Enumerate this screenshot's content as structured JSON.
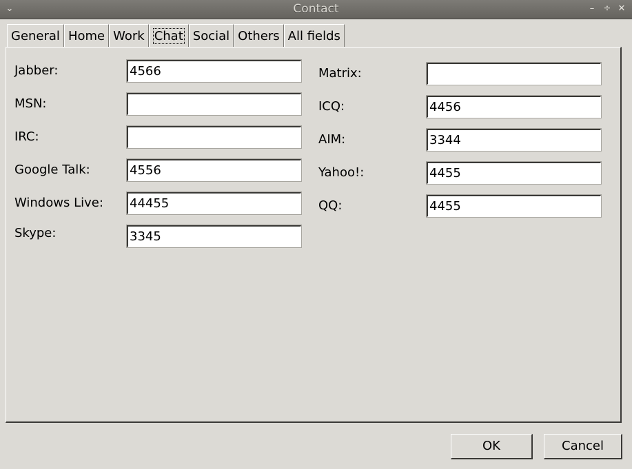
{
  "window": {
    "title": "Contact",
    "menu_icon": "chevron-down-icon",
    "minimize_icon": "minimize-icon",
    "maximize_icon": "maximize-icon",
    "close_icon": "close-icon"
  },
  "tabs": [
    {
      "label": "General",
      "active": false
    },
    {
      "label": "Home",
      "active": false
    },
    {
      "label": "Work",
      "active": false
    },
    {
      "label": "Chat",
      "active": true
    },
    {
      "label": "Social",
      "active": false
    },
    {
      "label": "Others",
      "active": false
    },
    {
      "label": "All fields",
      "active": false
    }
  ],
  "left_fields": [
    {
      "label": "Jabber:",
      "value": "4566"
    },
    {
      "label": "MSN:",
      "value": ""
    },
    {
      "label": "IRC:",
      "value": ""
    },
    {
      "label": "Google Talk:",
      "value": "4556"
    },
    {
      "label": "Windows Live:",
      "value": "44455"
    },
    {
      "label": "Skype:",
      "value": "3345"
    }
  ],
  "right_fields": [
    {
      "label": "Matrix:",
      "value": ""
    },
    {
      "label": "ICQ:",
      "value": "4456"
    },
    {
      "label": "AIM:",
      "value": "3344"
    },
    {
      "label": "Yahoo!:",
      "value": "4455"
    },
    {
      "label": "QQ:",
      "value": "4455"
    }
  ],
  "buttons": {
    "ok": "OK",
    "cancel": "Cancel"
  }
}
